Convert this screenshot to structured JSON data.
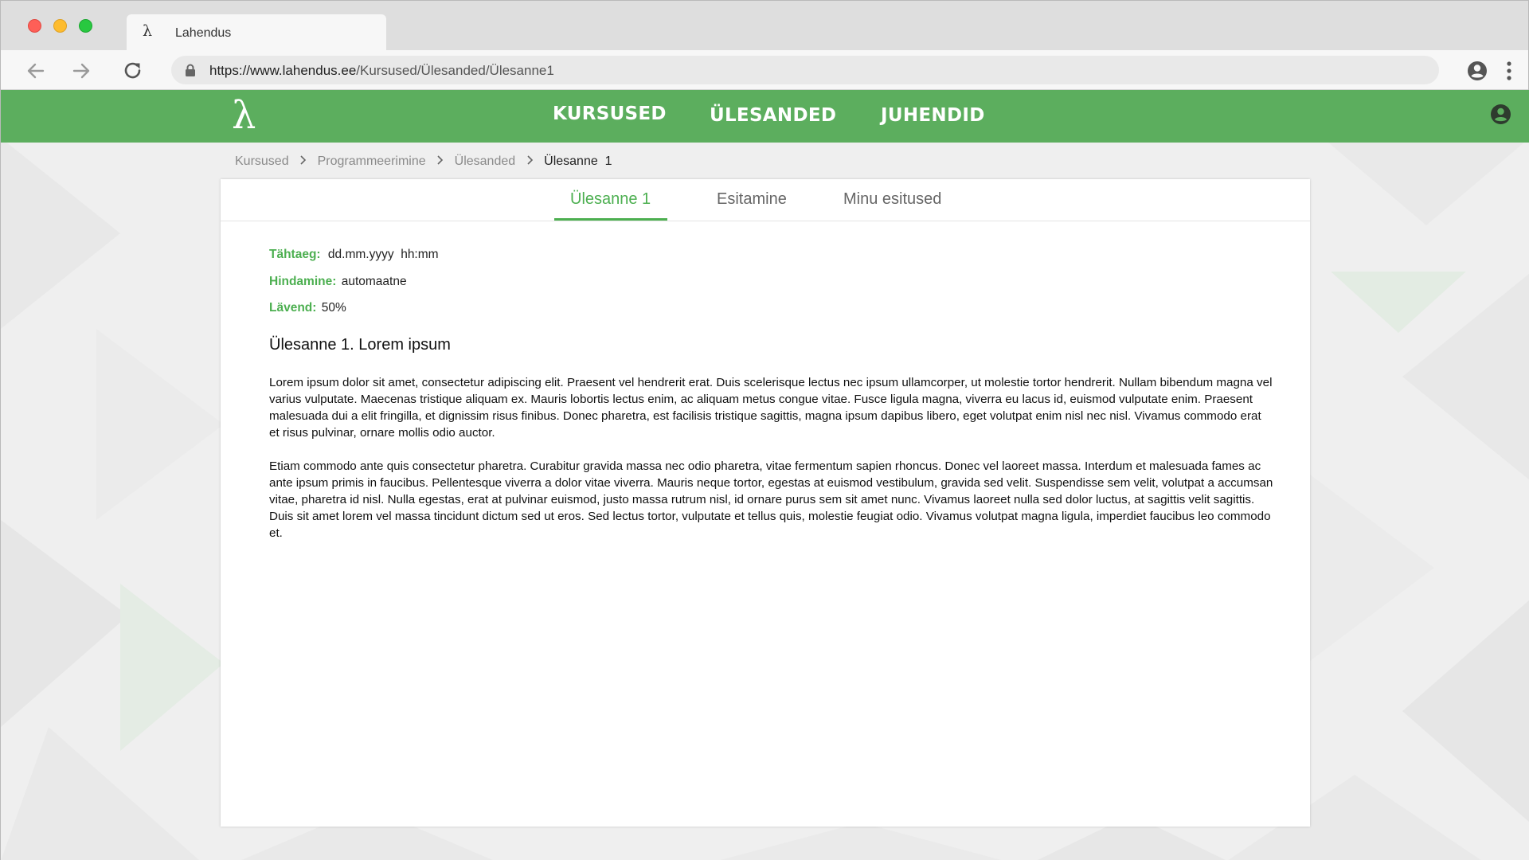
{
  "browser": {
    "tab_title": "Lahendus",
    "tab_favicon": "λ",
    "url_host": "https://www.lahendus.ee",
    "url_path": "/Kursused/Ülesanded/Ülesanne1"
  },
  "site": {
    "logo": "λ",
    "nav": [
      {
        "label": "KURSUSED"
      },
      {
        "label": "ÜLESANDED"
      },
      {
        "label": "JUHENDID"
      }
    ]
  },
  "breadcrumb": [
    {
      "label": "Kursused"
    },
    {
      "label": "Programmeerimine"
    },
    {
      "label": "Ülesanded"
    },
    {
      "label": "Ülesanne  1"
    }
  ],
  "tabs": [
    {
      "label": "Ülesanne 1",
      "active": true
    },
    {
      "label": "Esitamine",
      "active": false
    },
    {
      "label": "Minu esitused",
      "active": false
    }
  ],
  "meta": {
    "deadline_label": "Tähtaeg:",
    "deadline_value": "dd.mm.yyyy  hh:mm",
    "grading_label": "Hindamine:",
    "grading_value": "automaatne",
    "threshold_label": "Lävend:",
    "threshold_value": "50%"
  },
  "task": {
    "title": "Ülesanne 1. Lorem ipsum",
    "paragraphs": [
      "Lorem ipsum dolor sit amet, consectetur adipiscing elit. Praesent vel hendrerit erat. Duis scelerisque lectus nec ipsum ullamcorper, ut molestie tortor hendrerit. Nullam bibendum magna vel varius vulputate. Maecenas tristique aliquam ex. Mauris lobortis lectus enim, ac aliquam metus congue vitae. Fusce ligula magna, viverra eu lacus id, euismod vulputate enim. Praesent malesuada dui a elit fringilla, et dignissim risus finibus. Donec pharetra, est facilisis tristique sagittis, magna ipsum dapibus libero, eget volutpat enim nisl nec nisl. Vivamus commodo erat et risus pulvinar, ornare mollis odio auctor.",
      "Etiam commodo ante quis consectetur pharetra. Curabitur gravida massa nec odio pharetra, vitae fermentum sapien rhoncus. Donec vel laoreet massa. Interdum et malesuada fames ac ante ipsum primis in faucibus. Pellentesque viverra a dolor vitae viverra. Mauris neque tortor, egestas at euismod vestibulum, gravida sed velit. Suspendisse sem velit, volutpat a accumsan vitae, pharetra id nisl. Nulla egestas, erat at pulvinar euismod, justo massa rutrum nisl, id ornare purus sem sit amet nunc. Vivamus laoreet nulla sed dolor luctus, at sagittis velit sagittis. Duis sit amet lorem vel massa tincidunt dictum sed ut eros. Sed lectus tortor, vulputate et tellus quis, molestie feugiat odio. Vivamus volutpat magna ligula, imperdiet faucibus leo commodo et."
    ]
  },
  "colors": {
    "brand_green": "#5cae5e",
    "accent_green": "#4caf50"
  },
  "icons": {
    "back": "arrow-left-icon",
    "forward": "arrow-right-icon",
    "reload": "reload-icon",
    "lock": "lock-icon",
    "account": "account-circle-icon",
    "menu": "more-vertical-icon",
    "breadcrumb_separator": "chevron-right-icon"
  }
}
